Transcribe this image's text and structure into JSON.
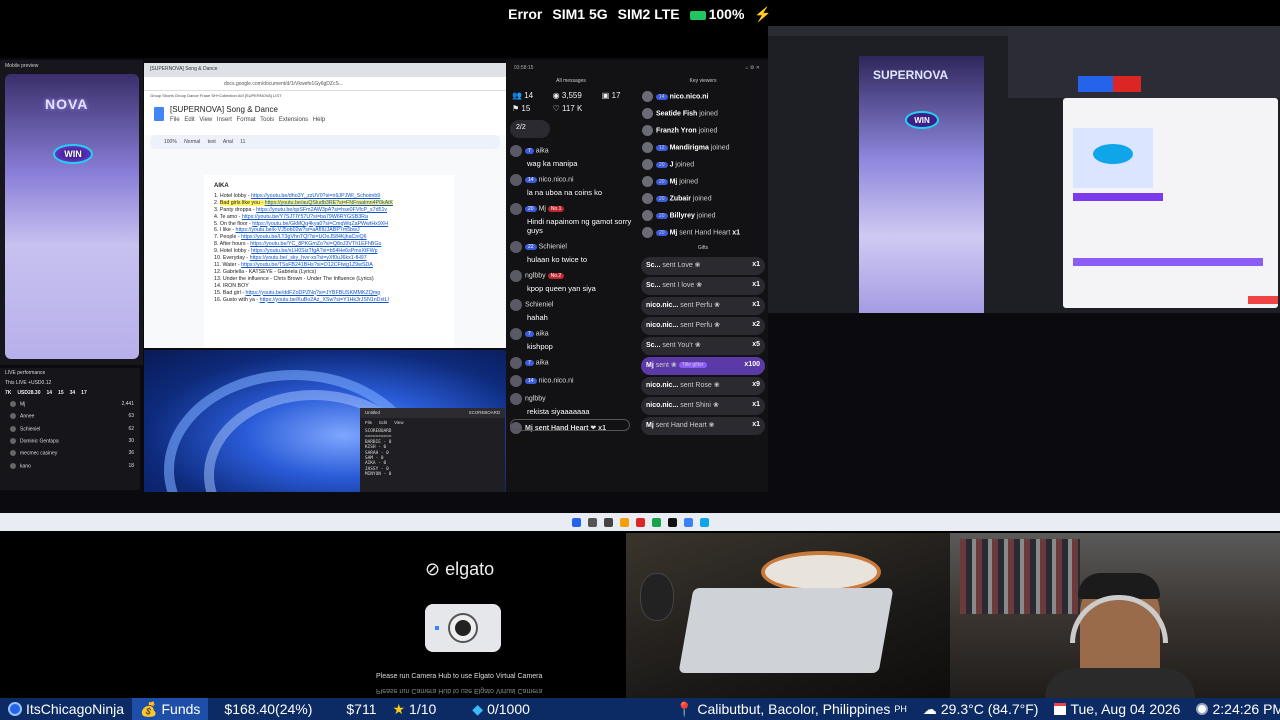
{
  "status_bar": {
    "error": "Error",
    "sim1": "SIM1 5G",
    "sim2": "SIM2 LTE",
    "battery": "100%"
  },
  "mobile_preview": {
    "title": "Mobile preview",
    "brand": "NOVA",
    "win": "WIN"
  },
  "live_performance": {
    "title": "LIVE performance",
    "subtitle": "This LIVE +USD0.12",
    "stats": [
      "7K",
      "USD28.30",
      "14",
      "15",
      "34",
      "17"
    ],
    "rows": [
      {
        "name": "Mj",
        "value": "2,441"
      },
      {
        "name": "Annee",
        "value": "63"
      },
      {
        "name": "Schieniel",
        "value": "62"
      },
      {
        "name": "Dominic Gentapa",
        "value": "30"
      },
      {
        "name": "mecmec casiney",
        "value": "36"
      },
      {
        "name": "kano",
        "value": "18"
      }
    ]
  },
  "docs": {
    "tab": "[SUPERNOVA] Song & Dance",
    "url": "docs.google.com/document/d/1rVkwefo1Gy6gDZcS...",
    "bookmarks": "Group Shorts   Group Dance   Fraue   SH+Collection AIII   [SUPERNOVA] LIST",
    "title": "[SUPERNOVA] Song & Dance",
    "menu": "File Edit View Insert Format Tools Extensions Help",
    "toolbar": "100%   Normal text   Arial   11",
    "heading": "AIKA",
    "lines": [
      {
        "t": "Hotel lobby - ",
        "link": "https://youtu.be/dho3Y_zzUV0?si=n9JPJWI_Schoimb9",
        "hl": false
      },
      {
        "t": "Bad girls like you - ",
        "link": "https://youtu.be/auQSludb3RE?si=FNFraalmn4P0kAiK",
        "hl": true
      },
      {
        "t": "Panty droppa - ",
        "link": "https://youtu.be/qsSFm2AW3pA?si=hse0FVfcP_s7d51v",
        "hl": false
      },
      {
        "t": "Te amo - ",
        "link": "https://youtu.be/Y7SJTIY57U?si=ba79W6RYGSB3Ra",
        "hl": false
      },
      {
        "t": "On the floor - ",
        "link": "https://youtu.be/GkMQq4kya0?si=CmqWqZaPWwtHx9XH",
        "hl": false
      },
      {
        "t": "I like - ",
        "link": "https://youtu.be/k-VJ5ob02w?si=aAfIlUJABP7m5bwJ",
        "hl": false
      },
      {
        "t": "People - ",
        "link": "https://youtu.be/LT3gVhnTQI?si=UOoJ584KjhaCniQ6",
        "hl": false
      },
      {
        "t": "After hours - ",
        "link": "https://youtu.be/YC_8PKGmZo?si=Q8oJ3VTh1EFhBGu",
        "hl": false
      },
      {
        "t": "Hotel lobby - ",
        "link": "https://youtu.be/xLH0SizTfgA?si=b54He6sPmsXtFWp",
        "hl": false
      },
      {
        "t": "Everyday - ",
        "link": "https://youtu.be/_sky_hvv-xs?si=yXf0uJ6kx1-fH97",
        "hl": false
      },
      {
        "t": "Water - ",
        "link": "https://youtu.be/TSsFB241BHs?si=O12CFtwg1Z9wSDA",
        "hl": false
      },
      {
        "t": "Gabriella - ",
        "link": "KATSEYE - Gabriela (Lyrics)",
        "hl": false,
        "plain": true
      },
      {
        "t": "Under the influence - ",
        "link": "Chris Brown - Under The Influence (Lyrics)",
        "hl": false,
        "plain": true
      },
      {
        "t": "IRON BOY",
        "link": "",
        "hl": false
      },
      {
        "t": "Bad girl - ",
        "link": "https://youtu.be/ddFZoDPZNq?si=JYBFBUSKMMKZQmg",
        "hl": false
      },
      {
        "t": "Gusto with ya - ",
        "link": "https://youtu.be/KuBo2Az_XSw?si=Y1Hk3rJSN1nDxtLl",
        "hl": false
      }
    ]
  },
  "notepad": {
    "title": "Untitled",
    "tab": "SCOREBOARD",
    "menu": "File  Edit  View",
    "text": "SCOREBOARD\n==========\nBARBIE - 0\nKISH - 0\nSARAH - 0\nSAM - 0\nAIKA - 0\nJASSY - 0\nMINYON - 0"
  },
  "chat": {
    "time": "03:58:15",
    "left_head": "All messages",
    "right_head": "Key viewers",
    "stats": [
      "14",
      "3,559",
      "17",
      "15",
      "117 K"
    ],
    "queue": "2/2",
    "messages": [
      {
        "level": "7",
        "name": "aika",
        "text": "wag ka manipa"
      },
      {
        "level": "14",
        "name": "nico.nico.ni",
        "text": "la na uboa na coins ko"
      },
      {
        "level": "20",
        "name": "Mj",
        "rank": "No.1",
        "text": "Hindi napainom ng gamot sorry guys"
      },
      {
        "level": "22",
        "name": "Schieniel",
        "text": "hulaan ko twice to"
      },
      {
        "level": "",
        "name": "nglbby",
        "rank": "No.2",
        "text": "kpop queen yan siya"
      },
      {
        "level": "",
        "name": "Schieniel",
        "text": "hahah"
      },
      {
        "level": "7",
        "name": "aika",
        "text": "kishpop"
      },
      {
        "level": "7",
        "name": "aika",
        "text": ""
      },
      {
        "level": "14",
        "name": "nico.nico.ni",
        "text": ""
      },
      {
        "level": "",
        "name": "nglbby",
        "text": "rekista siyaaaaaaa"
      }
    ],
    "last": "Mj sent Hand Heart",
    "last_count": "x1",
    "key_viewers": [
      {
        "level": "14",
        "name": "nico.nico.ni",
        "action": ""
      },
      {
        "level": "",
        "name": "Seatide Fish",
        "action": "joined"
      },
      {
        "level": "",
        "name": "Franzh Yron",
        "action": "joined"
      },
      {
        "level": "12",
        "name": "Mandirigma",
        "action": "joined"
      },
      {
        "level": "20",
        "name": "J",
        "action": "joined"
      },
      {
        "level": "20",
        "name": "Mj",
        "action": "joined"
      },
      {
        "level": "20",
        "name": "Zubair",
        "action": "joined"
      },
      {
        "level": "20",
        "name": "Billyrey",
        "action": "joined"
      },
      {
        "level": "20",
        "name": "Mj",
        "action": "sent Hand Heart",
        "count": "x1"
      }
    ],
    "gifts_head": "Gifts",
    "gifts": [
      {
        "name": "Sc...",
        "gift": "sent Love",
        "count": "x1"
      },
      {
        "name": "Sc...",
        "gift": "sent I love",
        "count": "x1"
      },
      {
        "name": "nico.nic...",
        "gift": "sent Perfu",
        "count": "x1"
      },
      {
        "name": "nico.nic...",
        "gift": "sent Perfu",
        "count": "x2"
      },
      {
        "name": "Sc...",
        "gift": "sent You'r",
        "count": "x5"
      },
      {
        "name": "Mj",
        "gift": "sent",
        "count": "x100",
        "tag": "Title gifter"
      },
      {
        "name": "nico.nic...",
        "gift": "sent Rose",
        "count": "x9"
      },
      {
        "name": "nico.nic...",
        "gift": "sent Shini",
        "count": "x1"
      },
      {
        "name": "Mj",
        "gift": "sent Hand Heart",
        "count": "x1"
      }
    ]
  },
  "obs": {
    "brand": "SUPERNOVA",
    "win": "WIN"
  },
  "elgato": {
    "logo": "elgato",
    "message": "Please run Camera Hub to use Elgato Virtual Camera",
    "mirror": "Please run Camera Hub to use Elgato Virtual Camera"
  },
  "ticker": {
    "channel": "ItsChicagoNinja",
    "funds_label": "Funds",
    "funds_value": "$168.40(24%)",
    "amount": "$711",
    "stars": "1/10",
    "gems": "0/1000",
    "location": "Calibutbut, Bacolor, Philippines",
    "country": "PH",
    "weather": "29.3°C (84.7°F)",
    "date": "Tue, Aug 04 2026",
    "time": "2:24:26 PM"
  },
  "colors": {
    "ticker_bg": "#0c2a63",
    "funds_bg": "#1e4fa8",
    "accent": "#7c3aed"
  }
}
